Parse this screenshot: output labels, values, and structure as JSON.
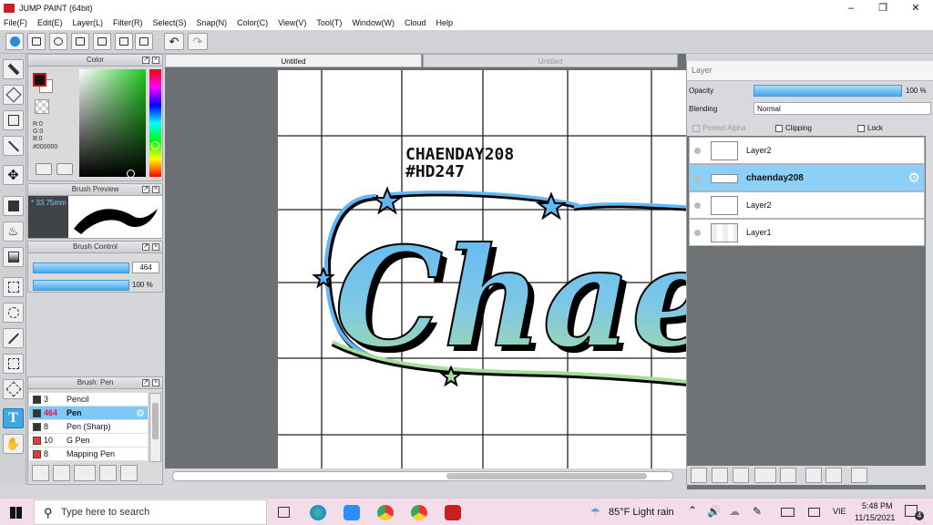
{
  "window": {
    "title": "JUMP PAINT (64bit)"
  },
  "menu": [
    "File(F)",
    "Edit(E)",
    "Layer(L)",
    "Filter(R)",
    "Select(S)",
    "Snap(N)",
    "Color(C)",
    "View(V)",
    "Tool(T)",
    "Window(W)",
    "Cloud",
    "Help"
  ],
  "color_panel": {
    "title": "Color",
    "r": "R:0",
    "g": "G:0",
    "b": "B:0",
    "hex": "#000000",
    "fg": "#000000",
    "bg": "#ffffff"
  },
  "brush_preview": {
    "title": "Brush Preview",
    "size": "33.75mm"
  },
  "brush_control": {
    "title": "Brush Control",
    "size_value": "464",
    "opacity_value": "100 %"
  },
  "brush_list": {
    "title": "Brush: Pen",
    "items": [
      {
        "size": "3",
        "name": "Pencil",
        "color": "#333333"
      },
      {
        "size": "464",
        "name": "Pen",
        "color": "#333333"
      },
      {
        "size": "8",
        "name": "Pen (Sharp)",
        "color": "#333333"
      },
      {
        "size": "10",
        "name": "G Pen",
        "color": "#e83a3a"
      },
      {
        "size": "8",
        "name": "Mapping Pen",
        "color": "#e83a3a"
      }
    ]
  },
  "documents": {
    "tabs": [
      "Untitled",
      "Untitled"
    ]
  },
  "canvas": {
    "text_line1": "CHAENDAY208",
    "text_line2": "#HD247",
    "art_text": "Chaenday",
    "gradient_top": "#5fb8f5",
    "gradient_bottom": "#a6dd9a"
  },
  "layer_panel": {
    "title": "Layer",
    "opacity_label": "Opacity",
    "opacity_value": "100 %",
    "opacity_level": 1.0,
    "blending_label": "Blending",
    "blending_value": "Normal",
    "protect_alpha": "Protect Alpha",
    "clipping": "Clipping",
    "lock": "Lock",
    "layers": [
      "Layer2",
      "chaenday208",
      "Layer2",
      "Layer1"
    ]
  },
  "taskbar": {
    "search_placeholder": "Type here to search",
    "weather": "85°F  Light rain",
    "language": "VIE",
    "time": "5:48 PM",
    "date": "11/15/2021",
    "notifications": "4"
  }
}
